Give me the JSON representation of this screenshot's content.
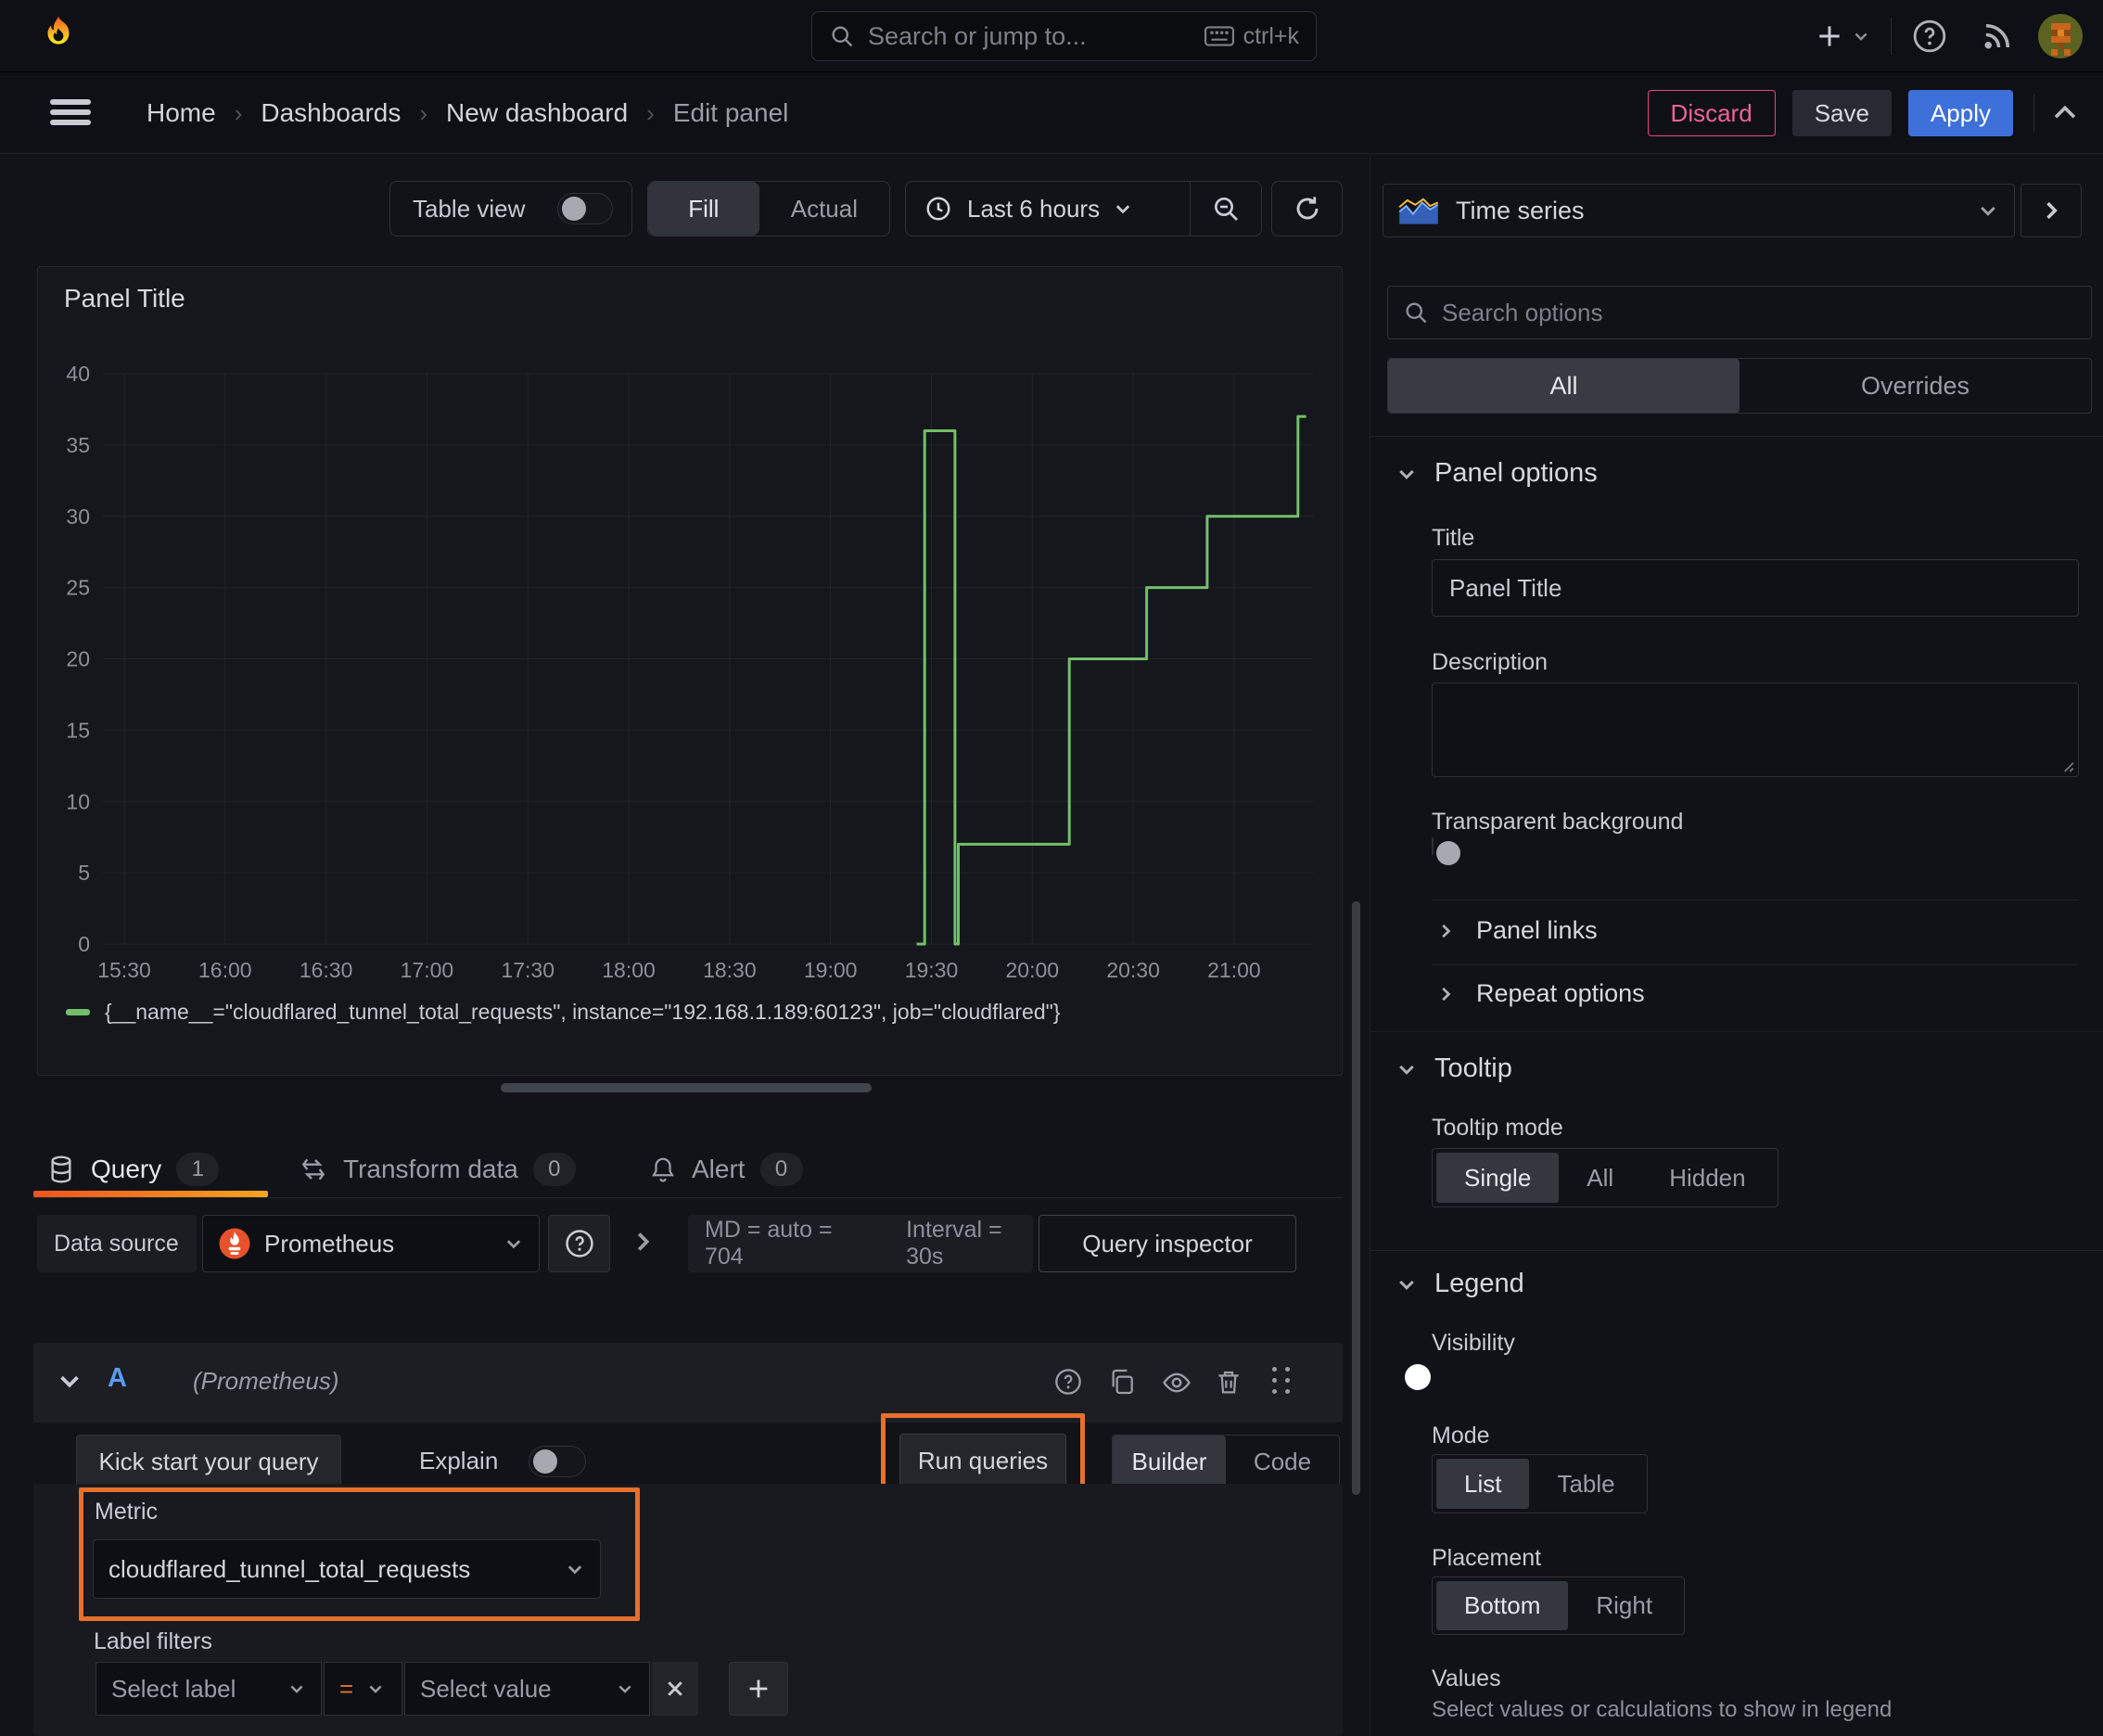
{
  "topbar": {
    "search_placeholder": "Search or jump to...",
    "search_shortcut": "ctrl+k"
  },
  "breadcrumb": {
    "items": [
      "Home",
      "Dashboards",
      "New dashboard",
      "Edit panel"
    ]
  },
  "header_actions": {
    "discard": "Discard",
    "save": "Save",
    "apply": "Apply"
  },
  "toolbar": {
    "table_view_label": "Table view",
    "fill_label": "Fill",
    "actual_label": "Actual",
    "time_range_label": "Last 6 hours"
  },
  "panel": {
    "title": "Panel Title",
    "legend_label": "{__name__=\"cloudflared_tunnel_total_requests\", instance=\"192.168.1.189:60123\", job=\"cloudflared\"}"
  },
  "chart_data": {
    "type": "line",
    "title": "Panel Title",
    "x_ticks": [
      "15:30",
      "16:00",
      "16:30",
      "17:00",
      "17:30",
      "18:00",
      "18:30",
      "19:00",
      "19:30",
      "20:00",
      "20:30",
      "21:00"
    ],
    "y_ticks": [
      0,
      5,
      10,
      15,
      20,
      25,
      30,
      35,
      40
    ],
    "ylim": [
      0,
      40
    ],
    "x_axis_minutes_after_1500": [
      30,
      360
    ],
    "grid": true,
    "legend_position": "bottom",
    "series": [
      {
        "name": "{__name__=\"cloudflared_tunnel_total_requests\", instance=\"192.168.1.189:60123\", job=\"cloudflared\"}",
        "color": "#73bf69",
        "points_min_value": [
          [
            266,
            0
          ],
          [
            268,
            0
          ],
          [
            268,
            36
          ],
          [
            277,
            36
          ],
          [
            277,
            0
          ],
          [
            278,
            0
          ],
          [
            278,
            7
          ],
          [
            311,
            7
          ],
          [
            311,
            20
          ],
          [
            334,
            20
          ],
          [
            334,
            25
          ],
          [
            352,
            25
          ],
          [
            352,
            30
          ],
          [
            379,
            30
          ],
          [
            379,
            37
          ],
          [
            381,
            37
          ]
        ]
      }
    ]
  },
  "tabs": {
    "query": {
      "label": "Query",
      "count": "1"
    },
    "transform": {
      "label": "Transform data",
      "count": "0"
    },
    "alert": {
      "label": "Alert",
      "count": "0"
    }
  },
  "datasource_row": {
    "label": "Data source",
    "name": "Prometheus",
    "stats": "MD = auto = 704",
    "interval": "Interval = 30s",
    "inspector": "Query inspector"
  },
  "query_row": {
    "ref_id": "A",
    "datasource_hint": "(Prometheus)"
  },
  "editor": {
    "kick_start": "Kick start your query",
    "explain": "Explain",
    "run_queries": "Run queries",
    "builder": "Builder",
    "code": "Code",
    "metric_label": "Metric",
    "metric_value": "cloudflared_tunnel_total_requests",
    "label_filters_label": "Label filters",
    "select_label_placeholder": "Select label",
    "operator": "=",
    "select_value_placeholder": "Select value"
  },
  "options_pane": {
    "viz_type": "Time series",
    "search_placeholder": "Search options",
    "tab_all": "All",
    "tab_overrides": "Overrides",
    "panel_options": {
      "header": "Panel options",
      "title_label": "Title",
      "title_value": "Panel Title",
      "description_label": "Description",
      "transparent_label": "Transparent background"
    },
    "panel_links_header": "Panel links",
    "repeat_header": "Repeat options",
    "tooltip": {
      "header": "Tooltip",
      "mode_label": "Tooltip mode",
      "modes": [
        "Single",
        "All",
        "Hidden"
      ],
      "selected": "Single"
    },
    "legend": {
      "header": "Legend",
      "visibility_label": "Visibility",
      "mode_label": "Mode",
      "modes": [
        "List",
        "Table"
      ],
      "selected_mode": "List",
      "placement_label": "Placement",
      "placements": [
        "Bottom",
        "Right"
      ],
      "selected_placement": "Bottom",
      "values_label": "Values",
      "values_desc": "Select values or calculations to show in legend"
    }
  },
  "colors": {
    "series_green": "#73bf69",
    "highlight_orange": "#e8702a",
    "apply_blue": "#3d71d9",
    "discard_pink": "#e0457f",
    "tab_underline_from": "#f0541e",
    "tab_underline_to": "#f8a320"
  }
}
